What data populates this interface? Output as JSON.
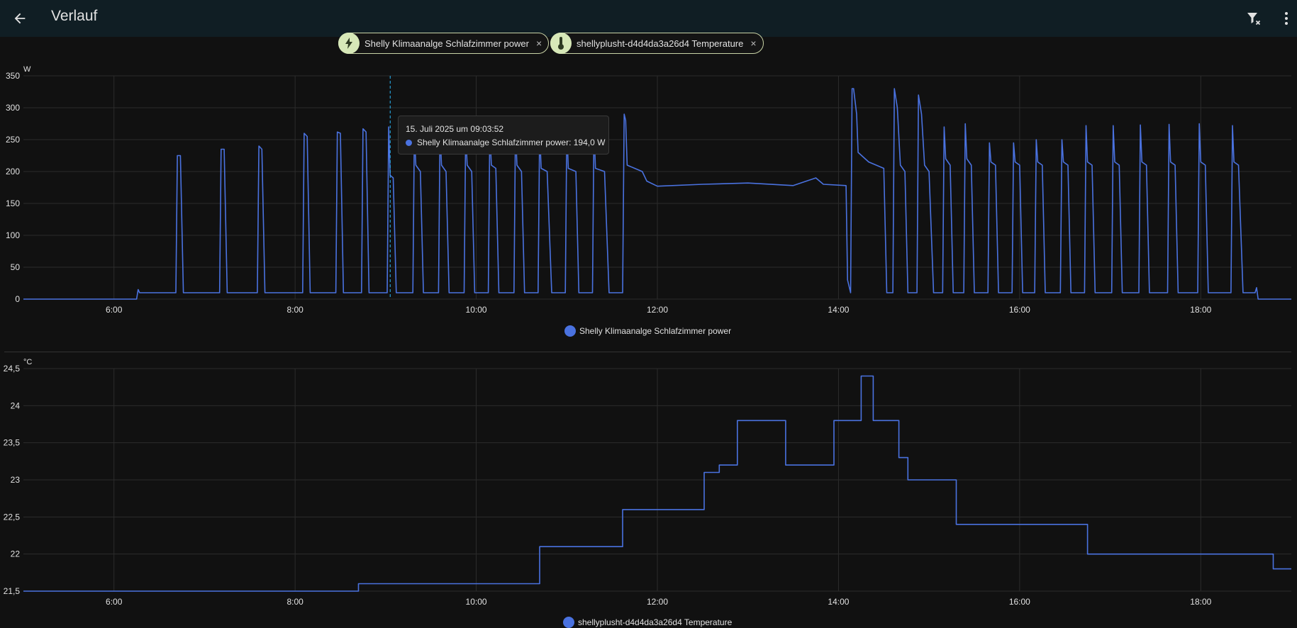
{
  "app": {
    "title": "Verlauf",
    "icons": {
      "back": "arrow-left-icon",
      "filter": "filter-remove-icon",
      "more": "dots-vertical-icon"
    }
  },
  "chips": [
    {
      "label": "Shelly Klimaanalge Schlafzimmer power",
      "icon": "lightning-bolt-icon",
      "close": "×"
    },
    {
      "label": "shellyplusht-d4d4da3a26d4 Temperature",
      "icon": "thermometer-icon",
      "close": "×"
    }
  ],
  "tooltip": {
    "title": "15. Juli 2025 um 09:03:52",
    "row": "Shelly Klimaanalge Schlafzimmer power: 194,0 W"
  },
  "colors": {
    "series": "#4a72e0",
    "accent": "#d7e8b8",
    "background": "#111111",
    "cursor": "#29b6f6"
  },
  "chart_data": [
    {
      "type": "line",
      "title": "",
      "ylabel": "W",
      "xlim": [
        "5:00",
        "19:00"
      ],
      "ylim": [
        0,
        350
      ],
      "x_ticks": [
        "6:00",
        "8:00",
        "10:00",
        "12:00",
        "14:00",
        "16:00",
        "18:00"
      ],
      "y_ticks": [
        "0",
        "50",
        "100",
        "150",
        "200",
        "250",
        "300",
        "350"
      ],
      "grid": true,
      "legend": "bottom-center",
      "series": [
        {
          "name": "Shelly Klimaanalge Schlafzimmer power",
          "points": [
            [
              "5:00",
              0
            ],
            [
              "6:15",
              0
            ],
            [
              "6:16",
              15
            ],
            [
              "6:17",
              10
            ],
            [
              "6:41",
              10
            ],
            [
              "6:42",
              225
            ],
            [
              "6:44",
              225
            ],
            [
              "6:46",
              10
            ],
            [
              "7:10",
              10
            ],
            [
              "7:11",
              235
            ],
            [
              "7:13",
              235
            ],
            [
              "7:15",
              10
            ],
            [
              "7:35",
              10
            ],
            [
              "7:36",
              240
            ],
            [
              "7:38",
              235
            ],
            [
              "7:40",
              10
            ],
            [
              "8:05",
              10
            ],
            [
              "8:06",
              260
            ],
            [
              "8:08",
              255
            ],
            [
              "8:10",
              10
            ],
            [
              "8:27",
              10
            ],
            [
              "8:28",
              262
            ],
            [
              "8:30",
              260
            ],
            [
              "8:32",
              10
            ],
            [
              "8:44",
              10
            ],
            [
              "8:45",
              267
            ],
            [
              "8:47",
              262
            ],
            [
              "8:49",
              10
            ],
            [
              "9:01",
              10
            ],
            [
              "9:02",
              270
            ],
            [
              "9:03",
              194
            ],
            [
              "9:05",
              190
            ],
            [
              "9:07",
              10
            ],
            [
              "9:18",
              10
            ],
            [
              "9:19",
              260
            ],
            [
              "9:20",
              210
            ],
            [
              "9:23",
              200
            ],
            [
              "9:25",
              10
            ],
            [
              "9:35",
              10
            ],
            [
              "9:36",
              265
            ],
            [
              "9:37",
              210
            ],
            [
              "9:40",
              200
            ],
            [
              "9:42",
              10
            ],
            [
              "9:52",
              10
            ],
            [
              "9:53",
              265
            ],
            [
              "9:54",
              210
            ],
            [
              "9:57",
              200
            ],
            [
              "9:59",
              10
            ],
            [
              "10:08",
              10
            ],
            [
              "10:09",
              265
            ],
            [
              "10:10",
              210
            ],
            [
              "10:13",
              205
            ],
            [
              "10:15",
              10
            ],
            [
              "10:25",
              10
            ],
            [
              "10:26",
              270
            ],
            [
              "10:27",
              210
            ],
            [
              "10:30",
              200
            ],
            [
              "10:32",
              10
            ],
            [
              "10:41",
              10
            ],
            [
              "10:42",
              265
            ],
            [
              "10:43",
              205
            ],
            [
              "10:47",
              200
            ],
            [
              "10:50",
              10
            ],
            [
              "10:59",
              10
            ],
            [
              "11:00",
              270
            ],
            [
              "11:01",
              205
            ],
            [
              "11:06",
              200
            ],
            [
              "11:08",
              10
            ],
            [
              "11:17",
              10
            ],
            [
              "11:18",
              270
            ],
            [
              "11:19",
              205
            ],
            [
              "11:25",
              200
            ],
            [
              "11:28",
              10
            ],
            [
              "11:37",
              10
            ],
            [
              "11:38",
              290
            ],
            [
              "11:39",
              280
            ],
            [
              "11:40",
              210
            ],
            [
              "11:45",
              205
            ],
            [
              "11:50",
              200
            ],
            [
              "11:53",
              185
            ],
            [
              "12:00",
              177
            ],
            [
              "12:30",
              180
            ],
            [
              "13:00",
              182
            ],
            [
              "13:30",
              178
            ],
            [
              "13:45",
              190
            ],
            [
              "13:50",
              180
            ],
            [
              "14:05",
              178
            ],
            [
              "14:06",
              30
            ],
            [
              "14:08",
              10
            ],
            [
              "14:09",
              330
            ],
            [
              "14:10",
              330
            ],
            [
              "14:12",
              290
            ],
            [
              "14:13",
              230
            ],
            [
              "14:20",
              215
            ],
            [
              "14:30",
              205
            ],
            [
              "14:32",
              10
            ],
            [
              "14:36",
              10
            ],
            [
              "14:37",
              330
            ],
            [
              "14:39",
              300
            ],
            [
              "14:41",
              210
            ],
            [
              "14:44",
              200
            ],
            [
              "14:46",
              10
            ],
            [
              "14:52",
              10
            ],
            [
              "14:53",
              320
            ],
            [
              "14:55",
              290
            ],
            [
              "14:57",
              210
            ],
            [
              "15:00",
              200
            ],
            [
              "15:03",
              10
            ],
            [
              "15:09",
              10
            ],
            [
              "15:10",
              270
            ],
            [
              "15:11",
              220
            ],
            [
              "15:14",
              210
            ],
            [
              "15:16",
              10
            ],
            [
              "15:23",
              10
            ],
            [
              "15:24",
              275
            ],
            [
              "15:25",
              220
            ],
            [
              "15:28",
              210
            ],
            [
              "15:30",
              10
            ],
            [
              "15:39",
              10
            ],
            [
              "15:40",
              245
            ],
            [
              "15:41",
              215
            ],
            [
              "15:44",
              210
            ],
            [
              "15:46",
              10
            ],
            [
              "15:55",
              10
            ],
            [
              "15:56",
              245
            ],
            [
              "15:57",
              215
            ],
            [
              "16:00",
              210
            ],
            [
              "16:02",
              10
            ],
            [
              "16:10",
              10
            ],
            [
              "16:11",
              250
            ],
            [
              "16:12",
              215
            ],
            [
              "16:15",
              210
            ],
            [
              "16:17",
              10
            ],
            [
              "16:27",
              10
            ],
            [
              "16:28",
              250
            ],
            [
              "16:29",
              215
            ],
            [
              "16:32",
              210
            ],
            [
              "16:34",
              10
            ],
            [
              "16:43",
              10
            ],
            [
              "16:44",
              272
            ],
            [
              "16:45",
              215
            ],
            [
              "16:48",
              210
            ],
            [
              "16:50",
              10
            ],
            [
              "17:01",
              10
            ],
            [
              "17:02",
              272
            ],
            [
              "17:03",
              215
            ],
            [
              "17:06",
              210
            ],
            [
              "17:08",
              10
            ],
            [
              "17:19",
              10
            ],
            [
              "17:20",
              273
            ],
            [
              "17:21",
              215
            ],
            [
              "17:24",
              210
            ],
            [
              "17:26",
              10
            ],
            [
              "17:38",
              10
            ],
            [
              "17:39",
              274
            ],
            [
              "17:40",
              215
            ],
            [
              "17:43",
              210
            ],
            [
              "17:45",
              10
            ],
            [
              "17:58",
              10
            ],
            [
              "17:59",
              275
            ],
            [
              "18:00",
              215
            ],
            [
              "18:03",
              210
            ],
            [
              "18:05",
              10
            ],
            [
              "18:20",
              10
            ],
            [
              "18:21",
              272
            ],
            [
              "18:22",
              215
            ],
            [
              "18:25",
              210
            ],
            [
              "18:28",
              10
            ],
            [
              "18:36",
              10
            ],
            [
              "18:37",
              18
            ],
            [
              "18:38",
              0
            ],
            [
              "19:00",
              0
            ]
          ]
        }
      ]
    },
    {
      "type": "line",
      "title": "",
      "ylabel": "°C",
      "xlim": [
        "5:00",
        "19:00"
      ],
      "ylim": [
        21.5,
        24.5
      ],
      "x_ticks": [
        "6:00",
        "8:00",
        "10:00",
        "12:00",
        "14:00",
        "16:00",
        "18:00"
      ],
      "y_ticks": [
        "21,5",
        "22",
        "22,5",
        "23",
        "23,5",
        "24",
        "24,5"
      ],
      "grid": true,
      "legend": "bottom-center",
      "step": true,
      "series": [
        {
          "name": "shellyplusht-d4d4da3a26d4 Temperature",
          "points": [
            [
              "5:00",
              21.5
            ],
            [
              "8:42",
              21.6
            ],
            [
              "10:42",
              22.1
            ],
            [
              "11:37",
              22.6
            ],
            [
              "12:31",
              23.1
            ],
            [
              "12:41",
              23.2
            ],
            [
              "12:53",
              23.8
            ],
            [
              "13:25",
              23.2
            ],
            [
              "13:57",
              23.8
            ],
            [
              "14:15",
              24.4
            ],
            [
              "14:23",
              23.8
            ],
            [
              "14:40",
              23.3
            ],
            [
              "14:46",
              23.0
            ],
            [
              "15:18",
              22.4
            ],
            [
              "16:45",
              22.0
            ],
            [
              "18:48",
              21.8
            ],
            [
              "19:00",
              21.8
            ]
          ]
        }
      ]
    }
  ]
}
